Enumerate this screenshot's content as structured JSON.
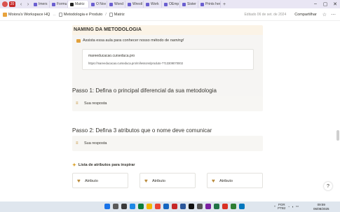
{
  "browser": {
    "tabs": [
      {
        "label": "Imers",
        "active": false
      },
      {
        "label": "Formu",
        "active": false
      },
      {
        "label": "Matriz",
        "active": true
      },
      {
        "label": "O Nov",
        "active": false
      },
      {
        "label": "Wond",
        "active": false
      },
      {
        "label": "Wrestl",
        "active": false
      },
      {
        "label": "Work",
        "active": false
      },
      {
        "label": "OEmp",
        "active": false
      },
      {
        "label": "Sister",
        "active": false
      },
      {
        "label": "Prints her",
        "active": false
      }
    ],
    "badge": "20"
  },
  "topbar": {
    "workspace": "Moiora's Workspace HQ",
    "ellipsis": "...",
    "crumb1": "Metodologia e Produto",
    "crumb2": "Matriz",
    "edited": "Editado 06 de set. de 2024",
    "share": "Compartilhar"
  },
  "naming": {
    "title": "NAMING DA METODOLOGIA",
    "prompt_text": "Assista essa aula para conhecer nosso método de ",
    "prompt_em": "naming!",
    "embed_domain": "mareeducacao.curseduca.pro",
    "embed_url": "https://mareeducacao.curseduca.pro/m/lessons/produto-?713309070002"
  },
  "step1": {
    "title": "Passo 1: Defina o principal diferencial da sua metodologia",
    "answer": "Sua resposta"
  },
  "step2": {
    "title": "Passo 2: Defina 3 atributos que o nome deve comunicar",
    "answer": "Sua resposta"
  },
  "attributes": {
    "title": "Lista de atributos para inspirar",
    "items": [
      "Atributo",
      "Atributo",
      "Atributo"
    ]
  },
  "help": "?",
  "taskbar": {
    "lang_top": "POR",
    "lang_bottom": "PTB2",
    "time": "09:59",
    "date": "06/08/2025"
  },
  "colors": {
    "naming_bg": "#fbf3e6",
    "tab_strip": "#e9e6f4",
    "accent_gold": "#b98a3b"
  }
}
